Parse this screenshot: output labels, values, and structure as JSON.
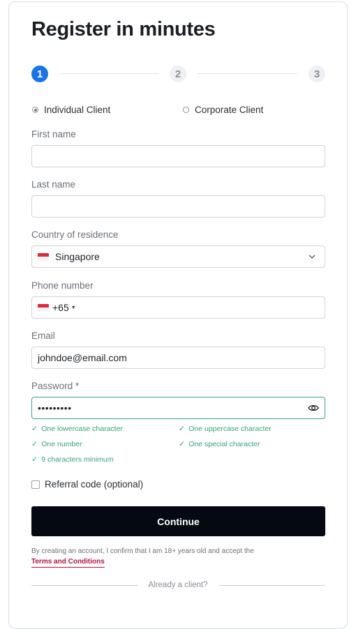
{
  "title": "Register in minutes",
  "steps": [
    "1",
    "2",
    "3"
  ],
  "client_type": {
    "individual": "Individual Client",
    "corporate": "Corporate Client"
  },
  "fields": {
    "first_name": {
      "label": "First name",
      "value": ""
    },
    "last_name": {
      "label": "Last name",
      "value": ""
    },
    "country": {
      "label": "Country of residence",
      "value": "Singapore"
    },
    "phone": {
      "label": "Phone number",
      "code": "+65",
      "value": ""
    },
    "email": {
      "label": "Email",
      "value": "johndoe@email.com"
    },
    "password": {
      "label": "Password *",
      "value": "•••••••••"
    }
  },
  "password_rules": [
    "One lowercase character",
    "One uppercase character",
    "One number",
    "One special character",
    "9 characters minimum"
  ],
  "referral_label": "Referral code (optional)",
  "continue_label": "Continue",
  "disclaimer": "By creating an account, I confirm that I am 18+ years old and accept the",
  "terms_label": "Terms and Conditions",
  "already_client": "Already a client?",
  "colors": {
    "accent": "#1a73e8",
    "success": "#3aa078",
    "button": "#050a12",
    "terms": "#b3123f"
  }
}
